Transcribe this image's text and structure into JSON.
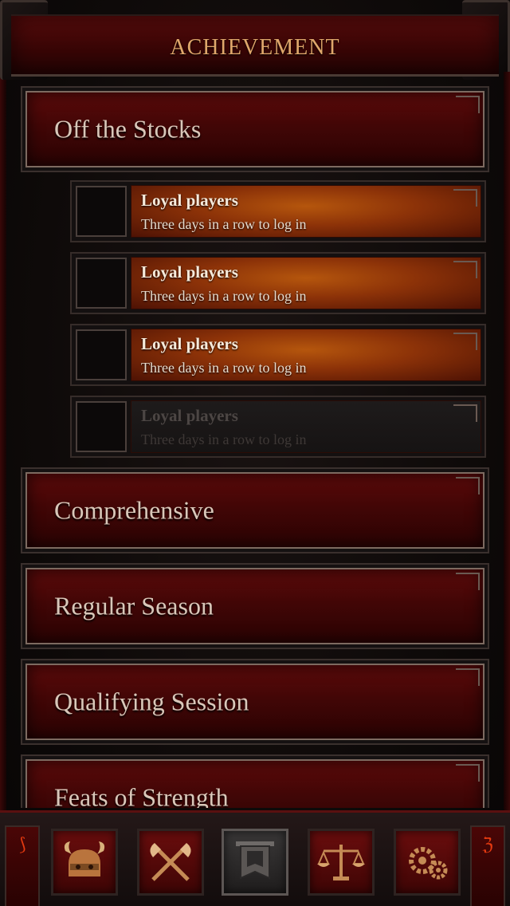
{
  "header": {
    "title": "ACHIEVEMENT"
  },
  "categories": [
    {
      "label": "Off the Stocks"
    },
    {
      "label": "Comprehensive"
    },
    {
      "label": "Regular Season"
    },
    {
      "label": "Qualifying Session"
    },
    {
      "label": "Feats of Strength"
    }
  ],
  "sub_items": [
    {
      "title": "Loyal players",
      "desc": "Three days in a row to log in",
      "state": "achieved"
    },
    {
      "title": "Loyal players",
      "desc": "Three days in a row to log in",
      "state": "achieved"
    },
    {
      "title": "Loyal players",
      "desc": "Three days in a row to log in",
      "state": "achieved"
    },
    {
      "title": "Loyal players",
      "desc": "Three days in a row to log in",
      "state": "locked"
    }
  ],
  "bottom_nav": {
    "items": [
      {
        "icon": "horned-helmet-icon"
      },
      {
        "icon": "crossed-axes-icon"
      },
      {
        "icon": "banner-shield-icon",
        "active": true
      },
      {
        "icon": "scales-icon"
      },
      {
        "icon": "gears-icon"
      }
    ],
    "left_tab_glyphs": "⟆",
    "right_tab_glyphs": "ℨ"
  },
  "colors": {
    "title_gold": "#e0a76b",
    "category_red": "#5c0a0a",
    "achieved_orange": "#b5560d",
    "locked_gray": "#1e1b1b"
  }
}
